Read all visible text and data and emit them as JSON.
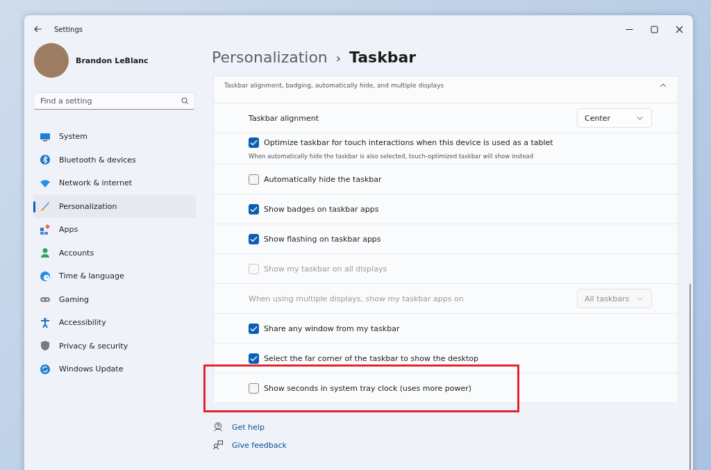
{
  "window": {
    "title": "Settings"
  },
  "user": {
    "name": "Brandon LeBlanc"
  },
  "search": {
    "placeholder": "Find a setting"
  },
  "sidebar": {
    "items": [
      {
        "label": "System",
        "selected": false
      },
      {
        "label": "Bluetooth & devices",
        "selected": false
      },
      {
        "label": "Network & internet",
        "selected": false
      },
      {
        "label": "Personalization",
        "selected": true
      },
      {
        "label": "Apps",
        "selected": false
      },
      {
        "label": "Accounts",
        "selected": false
      },
      {
        "label": "Time & language",
        "selected": false
      },
      {
        "label": "Gaming",
        "selected": false
      },
      {
        "label": "Accessibility",
        "selected": false
      },
      {
        "label": "Privacy & security",
        "selected": false
      },
      {
        "label": "Windows Update",
        "selected": false
      }
    ]
  },
  "breadcrumb": {
    "parent": "Personalization",
    "separator": "›",
    "current": "Taskbar"
  },
  "section": {
    "subtitle": "Taskbar alignment, badging, automatically hide, and multiple displays",
    "expanded": true,
    "rows": [
      {
        "kind": "dropdown",
        "label": "Taskbar alignment",
        "value": "Center",
        "disabled": false
      },
      {
        "kind": "checkbox",
        "label": "Optimize taskbar for touch interactions when this device is used as a tablet",
        "description": "When automatically hide the taskbar is also selected, touch-optimized taskbar will show instead",
        "checked": true,
        "disabled": false
      },
      {
        "kind": "checkbox",
        "label": "Automatically hide the taskbar",
        "checked": false,
        "disabled": false
      },
      {
        "kind": "checkbox",
        "label": "Show badges on taskbar apps",
        "checked": true,
        "disabled": false
      },
      {
        "kind": "checkbox",
        "label": "Show flashing on taskbar apps",
        "checked": true,
        "disabled": false
      },
      {
        "kind": "checkbox",
        "label": "Show my taskbar on all displays",
        "checked": false,
        "disabled": true
      },
      {
        "kind": "dropdown",
        "label": "When using multiple displays, show my taskbar apps on",
        "value": "All taskbars",
        "disabled": true
      },
      {
        "kind": "checkbox",
        "label": "Share any window from my taskbar",
        "checked": true,
        "disabled": false
      },
      {
        "kind": "checkbox",
        "label": "Select the far corner of the taskbar to show the desktop",
        "checked": true,
        "disabled": false
      },
      {
        "kind": "checkbox",
        "label": "Show seconds in system tray clock (uses more power)",
        "checked": false,
        "disabled": false,
        "highlighted": true
      }
    ]
  },
  "links": [
    "Get help",
    "Give feedback"
  ]
}
